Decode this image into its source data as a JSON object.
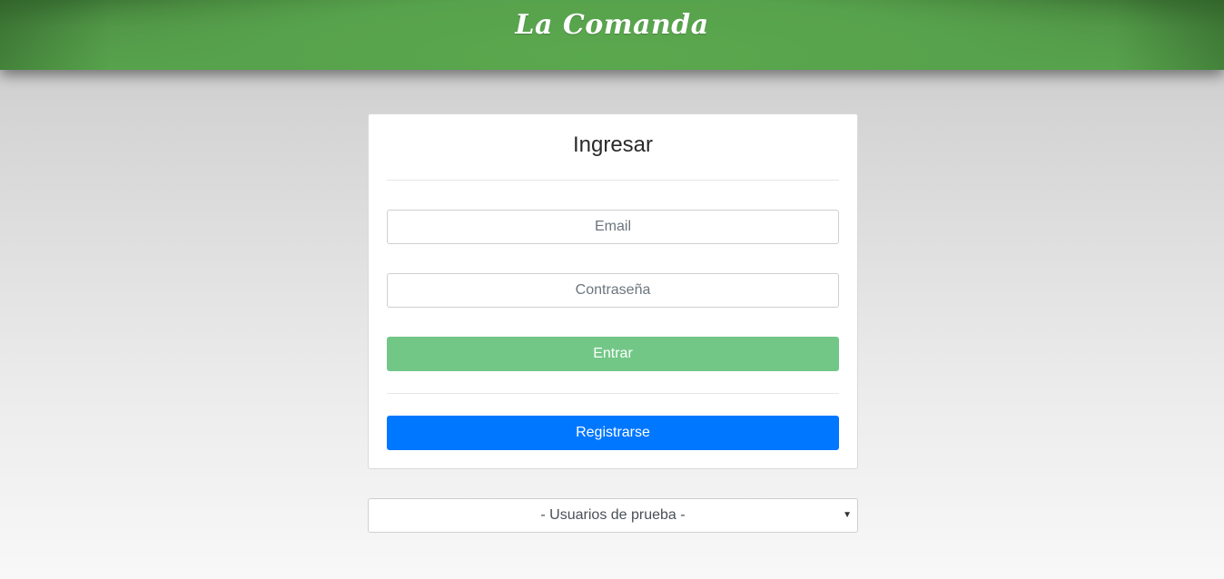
{
  "header": {
    "brand": "La Comanda",
    "background_color": "#58a34c"
  },
  "login": {
    "title": "Ingresar",
    "email_placeholder": "Email",
    "email_value": "",
    "password_placeholder": "Contraseña",
    "password_value": "",
    "enter_label": "Entrar",
    "enter_color": "#72c787",
    "register_label": "Registrarse",
    "register_color": "#0077ff"
  },
  "test_users": {
    "selected": "- Usuarios de prueba -",
    "caret_icon": "caret-down-icon"
  }
}
